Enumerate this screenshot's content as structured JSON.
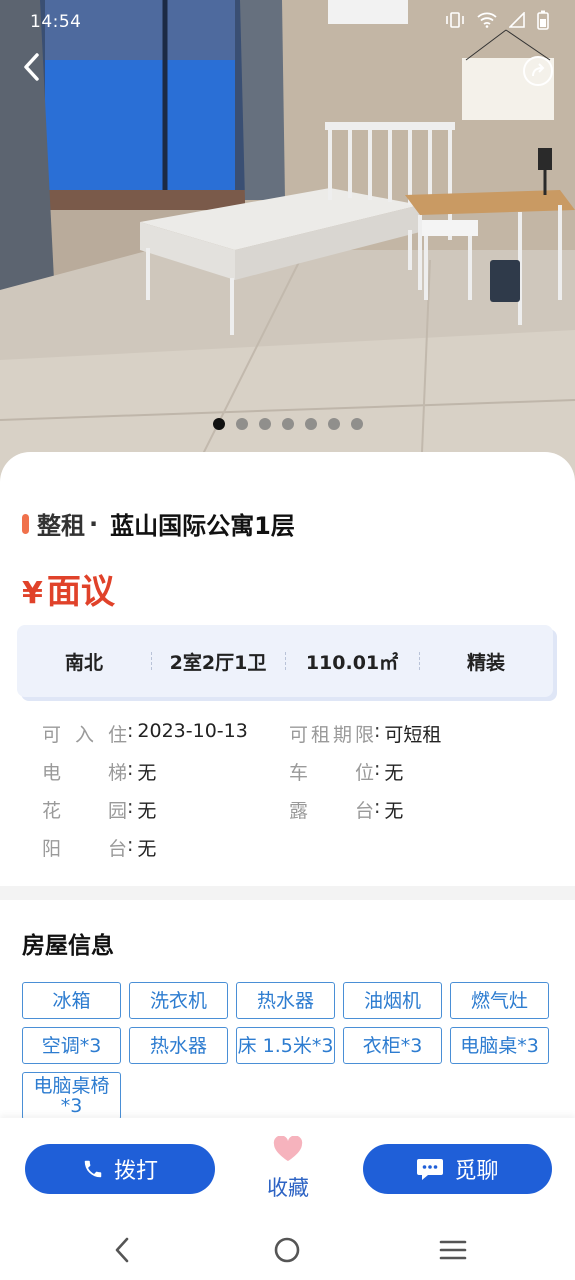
{
  "status_bar": {
    "time": "14:54"
  },
  "hero": {
    "photo_count": 7,
    "active_index": 0
  },
  "listing": {
    "type": "整租",
    "separator": "·",
    "name": "蓝山国际公寓1层",
    "price_symbol": "¥",
    "price": "面议"
  },
  "specs": [
    "南北",
    "2室2厅1卫",
    "110.01㎡",
    "精装"
  ],
  "attributes": [
    {
      "key": "可入住",
      "value": "2023-10-13"
    },
    {
      "key": "可租期限",
      "value": "可短租"
    },
    {
      "key": "电梯",
      "value": "无"
    },
    {
      "key": "车位",
      "value": "无"
    },
    {
      "key": "花园",
      "value": "无"
    },
    {
      "key": "露台",
      "value": "无"
    },
    {
      "key": "阳台",
      "value": "无"
    }
  ],
  "house_info": {
    "title": "房屋信息",
    "tags": [
      "冰箱",
      "洗衣机",
      "热水器",
      "油烟机",
      "燃气灶",
      "空调*3",
      "热水器",
      "床 1.5米*3",
      "衣柜*3",
      "电脑桌*3",
      "电脑桌椅*3"
    ]
  },
  "actions": {
    "call": "拨打",
    "favorite": "收藏",
    "chat": "觅聊"
  },
  "colors": {
    "accent_blue": "#1f5fd8",
    "price_red": "#e0422a",
    "tag_blue": "#2d7cd0",
    "heart_pink": "#f6b3bd"
  }
}
